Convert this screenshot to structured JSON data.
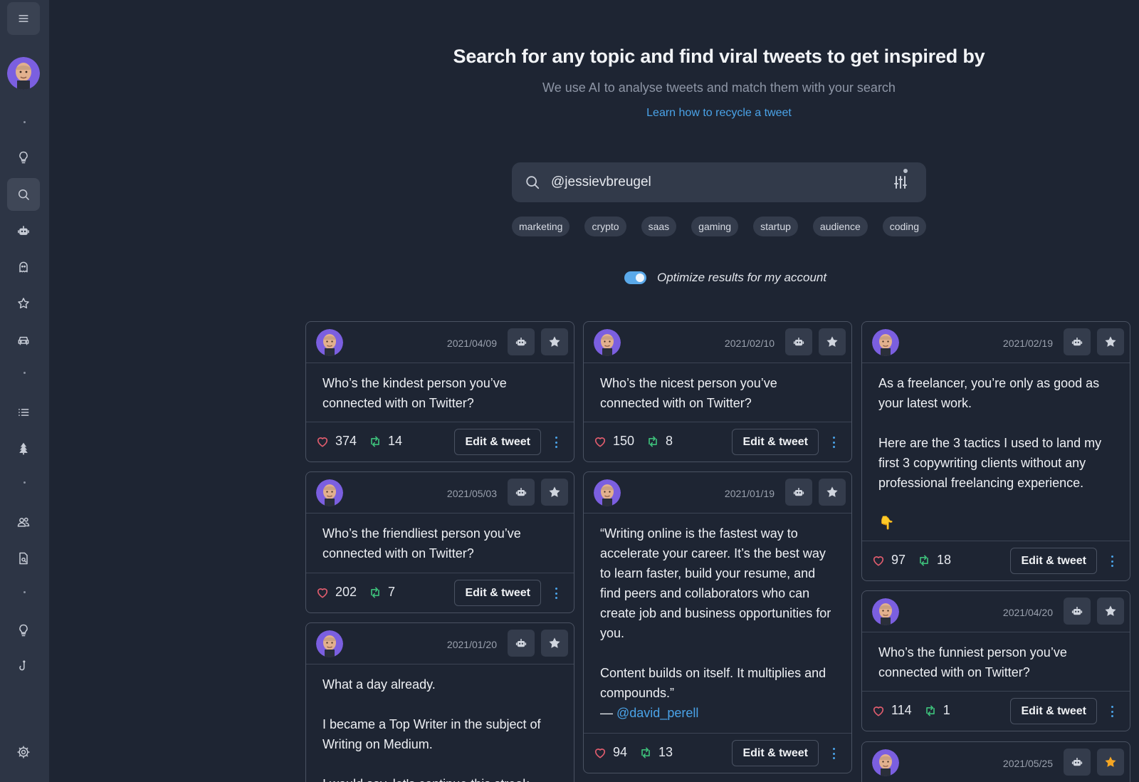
{
  "hero": {
    "title": "Search for any topic and find viral tweets to get inspired by",
    "subtitle": "We use AI to analyse tweets and match them with your search",
    "link": "Learn how to recycle a tweet"
  },
  "search": {
    "value": "@jessievbreugel"
  },
  "tags": [
    "marketing",
    "crypto",
    "saas",
    "gaming",
    "startup",
    "audience",
    "coding"
  ],
  "optimize": {
    "label": "Optimize results for my account",
    "enabled": true
  },
  "edit_label": "Edit & tweet",
  "sidebar_icons": [
    "menu-icon",
    "lightbulb-icon",
    "search-icon",
    "robot-icon",
    "ghost-icon",
    "star-icon",
    "car-icon",
    "list-icon",
    "tree-icon",
    "users-icon",
    "document-icon",
    "lightbulb-icon",
    "hook-icon",
    "gear-icon"
  ],
  "colors": {
    "accent": "#4aa3e8",
    "like": "#e25d6e",
    "retweet": "#3dbf7a",
    "star_active": "#f5a623",
    "background": "#1e2533",
    "sidebar": "#2d3545"
  },
  "cards": {
    "c1": {
      "date": "2021/04/09",
      "text": "Who’s the kindest person you’ve connected with on Twitter?",
      "likes": "374",
      "retweets": "14"
    },
    "c2": {
      "date": "2021/05/03",
      "text": "Who’s the friendliest person you’ve connected with on Twitter?",
      "likes": "202",
      "retweets": "7"
    },
    "c3": {
      "date": "2021/01/20",
      "text": "What a day already.\n\nI became a Top Writer in the subject of Writing on Medium.\n\nI would say, let's continue this streak"
    },
    "c4": {
      "date": "2021/02/10",
      "text": "Who’s the nicest person you’ve connected with on Twitter?",
      "likes": "150",
      "retweets": "8"
    },
    "c5": {
      "date": "2021/01/19",
      "text": "“Writing online is the fastest way to accelerate your career. It’s the best way to learn faster, build your resume, and find peers and collaborators who can create job and business opportunities for you.\n\nContent builds on itself. It multiplies and compounds.”",
      "dash": "— ",
      "mention": "@david_perell",
      "likes": "94",
      "retweets": "13"
    },
    "c6": {
      "date": "2021/02/19",
      "text": "As a freelancer, you’re only as good as your latest work.\n\nHere are the 3 tactics I used to land my first 3 copywriting clients without any professional freelancing experience.\n\n👇",
      "likes": "97",
      "retweets": "18"
    },
    "c7": {
      "date": "2021/04/20",
      "text": "Who’s the funniest person you’ve connected with on Twitter?",
      "likes": "114",
      "retweets": "1"
    },
    "c8": {
      "date": "2021/05/25",
      "starred": true
    }
  }
}
